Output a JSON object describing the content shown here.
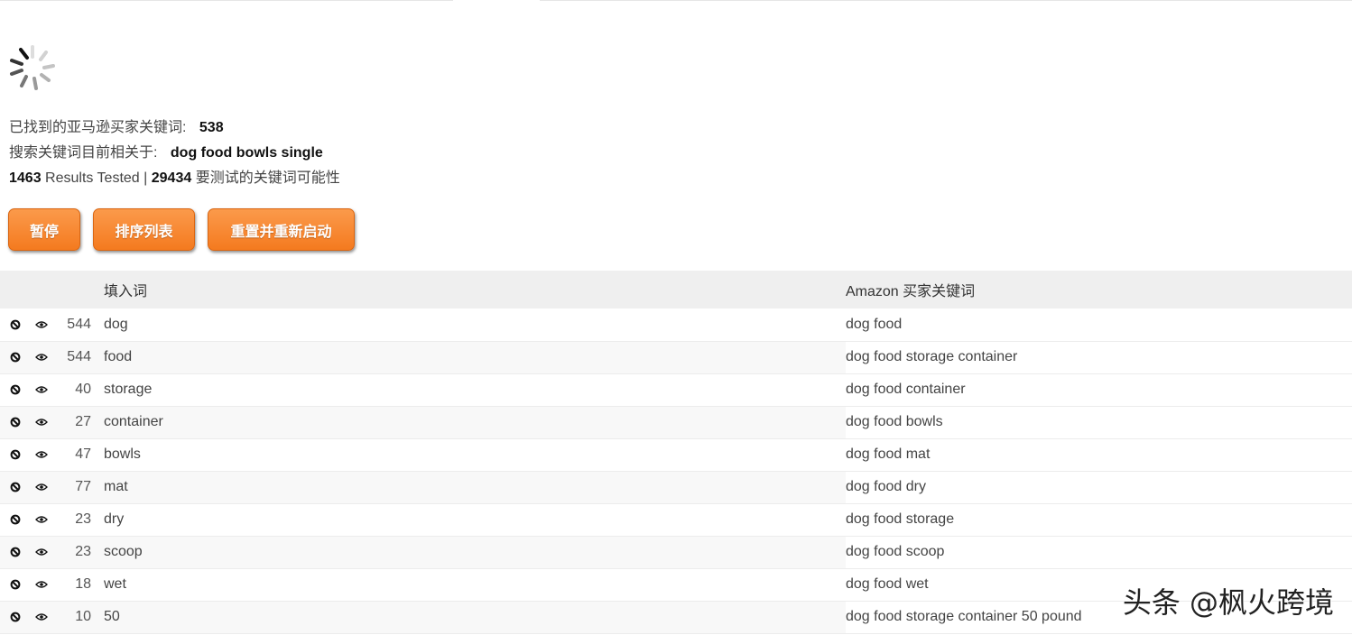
{
  "stats": {
    "found_label": "已找到的亚马逊买家关键词:",
    "found_count": "538",
    "current_label": "搜索关键词目前相关于:",
    "current_keyword": "dog food bowls single",
    "tested_count": "1463",
    "tested_label": "Results Tested |",
    "possible_count": "29434",
    "possible_label": "要测试的关键词可能性"
  },
  "buttons": {
    "pause": "暂停",
    "sort": "排序列表",
    "reset": "重置并重新启动"
  },
  "table": {
    "headers": {
      "seed": "填入词",
      "keyword": "Amazon 买家关键词"
    },
    "rows": [
      {
        "count": "544",
        "seed": "dog",
        "keyword": "dog food"
      },
      {
        "count": "544",
        "seed": "food",
        "keyword": "dog food storage container"
      },
      {
        "count": "40",
        "seed": "storage",
        "keyword": "dog food container"
      },
      {
        "count": "27",
        "seed": "container",
        "keyword": "dog food bowls"
      },
      {
        "count": "47",
        "seed": "bowls",
        "keyword": "dog food mat"
      },
      {
        "count": "77",
        "seed": "mat",
        "keyword": "dog food dry"
      },
      {
        "count": "23",
        "seed": "dry",
        "keyword": "dog food storage"
      },
      {
        "count": "23",
        "seed": "scoop",
        "keyword": "dog food scoop"
      },
      {
        "count": "18",
        "seed": "wet",
        "keyword": "dog food wet"
      },
      {
        "count": "10",
        "seed": "50",
        "keyword": "dog food storage container 50 pound"
      }
    ]
  },
  "icons": {
    "block": "block-icon",
    "view": "eye-icon",
    "loading": "spinner-icon"
  },
  "colors": {
    "button": "#f47a1f",
    "header_bg": "#efefef"
  },
  "watermark": "头条 @枫火跨境"
}
